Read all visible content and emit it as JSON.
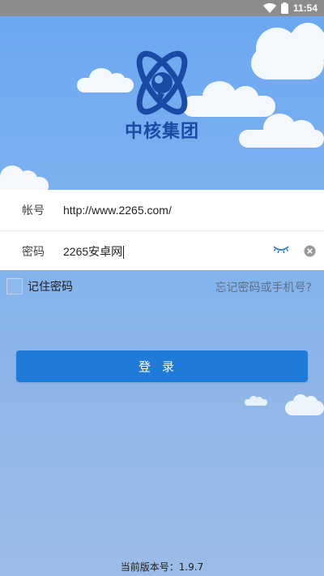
{
  "status_bar": {
    "time": "11:54"
  },
  "brand": {
    "name": "中核集团",
    "color": "#1a4aa6"
  },
  "form": {
    "account": {
      "label": "帐号",
      "value": "http://www.2265.com/"
    },
    "password": {
      "label": "密码",
      "value": "2265安卓网"
    }
  },
  "remember": {
    "label": "记住密码",
    "checked": false
  },
  "forgot_link": "忘记密码或手机号?",
  "login_button": "登录",
  "version_text": "当前版本号：1.9.7",
  "icons": {
    "wifi": "wifi-icon",
    "battery": "battery-icon",
    "eye": "eye-closed-icon",
    "clear": "clear-icon"
  },
  "colors": {
    "primary_button": "#1f7ad8",
    "eye_icon": "#1e7ad2",
    "sky": "#7db1ef"
  }
}
